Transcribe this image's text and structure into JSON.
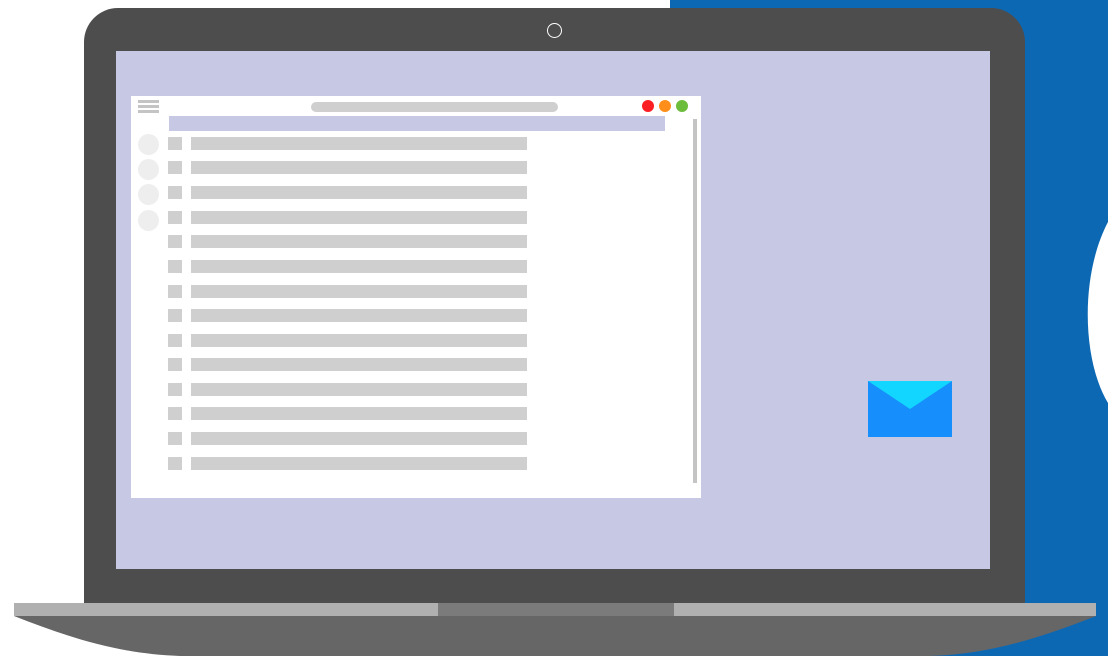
{
  "colors": {
    "background": "#ffffff",
    "blue_shape": "#0d68b4",
    "laptop_bezel": "#4d4d4d",
    "screen_desktop": "#c7c8e3",
    "window_bg": "#ffffff",
    "placeholder_gray": "#cfcfcf",
    "avatar_gray": "#eeeeee",
    "close_dot": "#fb1f24",
    "minimize_dot": "#ff8f1a",
    "maximize_dot": "#6cbd3c",
    "mail_body": "#168ffc",
    "mail_flap": "#12d6ff",
    "base_light": "#b0b0b0",
    "base_dark": "#666666"
  },
  "icons": {
    "menu": "hamburger-menu-icon",
    "camera": "webcam-icon",
    "mail": "envelope-icon"
  },
  "window": {
    "list_row_count": 14,
    "avatar_count": 4
  }
}
